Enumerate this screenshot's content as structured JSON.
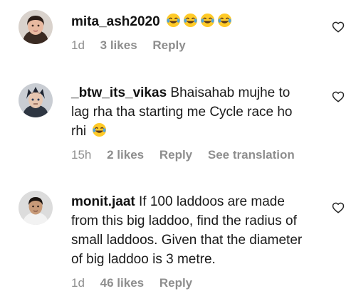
{
  "comments": [
    {
      "username": "mita_ash2020",
      "text": "",
      "emojis": [
        "tears-of-joy",
        "tears-of-joy",
        "tears-of-joy",
        "tears-of-joy"
      ],
      "time": "1d",
      "likes": "3 likes",
      "reply": "Reply"
    },
    {
      "username": "_btw_its_vikas",
      "text": "Bhaisahab mujhe to lag rha tha starting me Cycle race ho rhi",
      "emojis": [
        "tears-of-joy"
      ],
      "time": "15h",
      "likes": "2 likes",
      "reply": "Reply",
      "translation": "See translation"
    },
    {
      "username": "monit.jaat",
      "text": "If 100 laddoos are made from this big laddoo, find the radius of small laddoos. Given that the diameter of big laddoo is 3 metre.",
      "time": "1d",
      "likes": "46 likes",
      "reply": "Reply"
    }
  ],
  "icons": {
    "like": "heart-outline-icon",
    "emoji": "face-with-tears-of-joy"
  },
  "colors": {
    "text": "#1a1a1a",
    "meta": "#8e8e8e",
    "emoji_face": "#ffca28",
    "emoji_tear": "#4fa3e0"
  }
}
